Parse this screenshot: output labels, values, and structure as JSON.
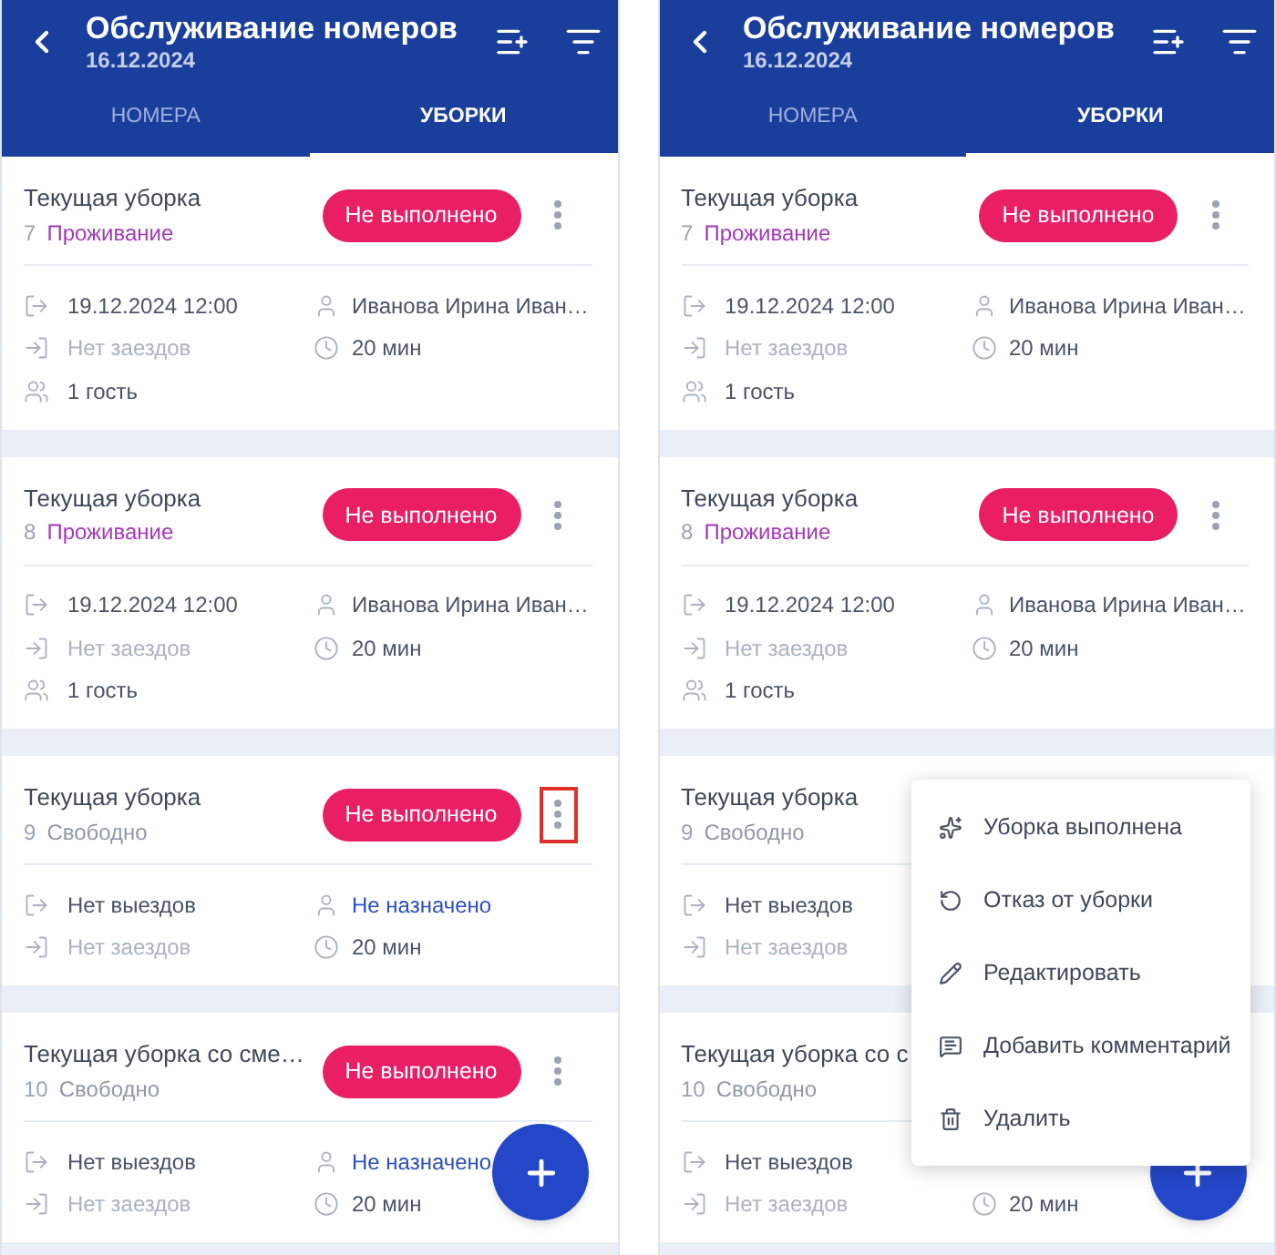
{
  "screens": [
    {
      "header": {
        "title": "Обслуживание номеров",
        "date": "16.12.2024"
      },
      "tabs": [
        {
          "label": "НОМЕРА",
          "selected": false
        },
        {
          "label": "УБОРКИ",
          "selected": true
        }
      ],
      "cards": [
        {
          "title": "Текущая уборка",
          "room": "7",
          "room_status": {
            "label": "Проживание",
            "kind": "occupied"
          },
          "status": "Не выполнено",
          "menu_button": {
            "highlighted": false
          },
          "rows": [
            {
              "left": {
                "kind": "departure",
                "text": "19.12.2024 12:00",
                "muted": false
              },
              "right": {
                "kind": "assignee",
                "text": "Иванова Ирина Иван…",
                "muted": false
              }
            },
            {
              "left": {
                "kind": "arrival",
                "text": "Нет заездов",
                "muted": true
              },
              "right": {
                "kind": "duration",
                "text": "20 мин",
                "muted": false
              }
            },
            {
              "left": {
                "kind": "guests",
                "text": "1 гость",
                "muted": false
              }
            }
          ]
        },
        {
          "title": "Текущая уборка",
          "room": "8",
          "room_status": {
            "label": "Проживание",
            "kind": "occupied"
          },
          "status": "Не выполнено",
          "menu_button": {
            "highlighted": false
          },
          "rows": [
            {
              "left": {
                "kind": "departure",
                "text": "19.12.2024 12:00",
                "muted": false
              },
              "right": {
                "kind": "assignee",
                "text": "Иванова Ирина Иван…",
                "muted": false
              }
            },
            {
              "left": {
                "kind": "arrival",
                "text": "Нет заездов",
                "muted": true
              },
              "right": {
                "kind": "duration",
                "text": "20 мин",
                "muted": false
              }
            },
            {
              "left": {
                "kind": "guests",
                "text": "1 гость",
                "muted": false
              }
            }
          ]
        },
        {
          "title": "Текущая уборка",
          "room": "9",
          "room_status": {
            "label": "Свободно",
            "kind": "free"
          },
          "status": "Не выполнено",
          "menu_button": {
            "highlighted": true
          },
          "rows": [
            {
              "left": {
                "kind": "departure",
                "text": "Нет выездов",
                "muted": false
              },
              "right": {
                "kind": "unassigned",
                "text": "Не назначено",
                "muted": false
              }
            },
            {
              "left": {
                "kind": "arrival",
                "text": "Нет заездов",
                "muted": true
              },
              "right": {
                "kind": "duration",
                "text": "20 мин",
                "muted": false
              }
            }
          ]
        },
        {
          "title": "Текущая уборка со сме…",
          "room": "10",
          "room_status": {
            "label": "Свободно",
            "kind": "free"
          },
          "status": "Не выполнено",
          "menu_button": {
            "highlighted": false
          },
          "rows": [
            {
              "left": {
                "kind": "departure",
                "text": "Нет выездов",
                "muted": false
              },
              "right": {
                "kind": "unassigned",
                "text": "Не назначено",
                "muted": false
              }
            },
            {
              "left": {
                "kind": "arrival",
                "text": "Нет заездов",
                "muted": true
              },
              "right": {
                "kind": "duration",
                "text": "20 мин",
                "muted": false
              }
            }
          ]
        }
      ],
      "add_button": true
    },
    {
      "header": {
        "title": "Обслуживание номеров",
        "date": "16.12.2024"
      },
      "tabs": [
        {
          "label": "НОМЕРА",
          "selected": false
        },
        {
          "label": "УБОРКИ",
          "selected": true
        }
      ],
      "cards": [
        {
          "title": "Текущая уборка",
          "room": "7",
          "room_status": {
            "label": "Проживание",
            "kind": "occupied"
          },
          "status": "Не выполнено",
          "menu_button": {
            "highlighted": false
          },
          "rows": [
            {
              "left": {
                "kind": "departure",
                "text": "19.12.2024 12:00",
                "muted": false
              },
              "right": {
                "kind": "assignee",
                "text": "Иванова Ирина Иван…",
                "muted": false
              }
            },
            {
              "left": {
                "kind": "arrival",
                "text": "Нет заездов",
                "muted": true
              },
              "right": {
                "kind": "duration",
                "text": "20 мин",
                "muted": false
              }
            },
            {
              "left": {
                "kind": "guests",
                "text": "1 гость",
                "muted": false
              }
            }
          ]
        },
        {
          "title": "Текущая уборка",
          "room": "8",
          "room_status": {
            "label": "Проживание",
            "kind": "occupied"
          },
          "status": "Не выполнено",
          "menu_button": {
            "highlighted": false
          },
          "rows": [
            {
              "left": {
                "kind": "departure",
                "text": "19.12.2024 12:00",
                "muted": false
              },
              "right": {
                "kind": "assignee",
                "text": "Иванова Ирина Иван…",
                "muted": false
              }
            },
            {
              "left": {
                "kind": "arrival",
                "text": "Нет заездов",
                "muted": true
              },
              "right": {
                "kind": "duration",
                "text": "20 мин",
                "muted": false
              }
            },
            {
              "left": {
                "kind": "guests",
                "text": "1 гость",
                "muted": false
              }
            }
          ]
        },
        {
          "title": "Текущая уборка",
          "room": "9",
          "room_status": {
            "label": "Свободно",
            "kind": "free"
          },
          "rows": [
            {
              "left": {
                "kind": "departure",
                "text": "Нет выездов",
                "muted": false
              }
            },
            {
              "left": {
                "kind": "arrival",
                "text": "Нет заездов",
                "muted": true
              }
            }
          ]
        },
        {
          "title": "Текущая уборка со с",
          "room": "10",
          "room_status": {
            "label": "Свободно",
            "kind": "free"
          },
          "rows": [
            {
              "left": {
                "kind": "departure",
                "text": "Нет выездов",
                "muted": false
              }
            },
            {
              "left": {
                "kind": "arrival",
                "text": "Нет заездов",
                "muted": true
              },
              "right": {
                "kind": "duration",
                "text": "20 мин",
                "muted": false
              }
            }
          ]
        }
      ],
      "add_button": true,
      "popup_menu": {
        "items": [
          {
            "kind": "done",
            "label": "Уборка выполнена"
          },
          {
            "kind": "refuse",
            "label": "Отказ от уборки"
          },
          {
            "kind": "edit",
            "label": "Редактировать"
          },
          {
            "kind": "comment",
            "label": "Добавить комментарий"
          },
          {
            "kind": "delete",
            "label": "Удалить"
          }
        ]
      }
    }
  ]
}
